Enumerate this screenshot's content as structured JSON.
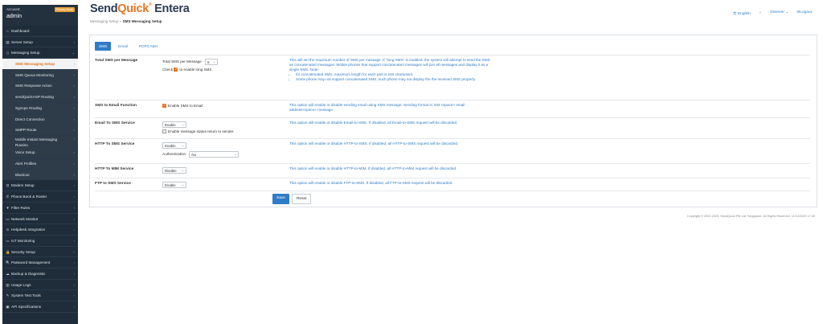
{
  "account": {
    "label": "Account:",
    "name": "admin",
    "badge": "Primary Node"
  },
  "sidebar": {
    "items": [
      {
        "icon": "⌂",
        "label": "Dashboard",
        "chevron": ""
      },
      {
        "icon": "▤",
        "label": "Server Setup",
        "chevron": "›"
      },
      {
        "icon": "▯",
        "label": "Messaging Setup",
        "chevron": "⌄"
      },
      {
        "label": "SMS Messaging Setup",
        "chevron": "›"
      },
      {
        "label": "SMS Queue Monitoring",
        "chevron": "›"
      },
      {
        "label": "SMS Response Action",
        "chevron": "›"
      },
      {
        "label": "sendQuickASP Routing",
        "chevron": "›"
      },
      {
        "label": "Sgnope Routing",
        "chevron": "›"
      },
      {
        "label": "Direct Connection",
        "chevron": "›"
      },
      {
        "label": "SMPP Route",
        "chevron": "›"
      },
      {
        "label": "Mobile Instant Messaging Routing",
        "chevron": "›"
      },
      {
        "label": "Voice Setup",
        "chevron": "›"
      },
      {
        "label": "Alert Profiles",
        "chevron": "›"
      },
      {
        "label": "Blackout",
        "chevron": "›"
      },
      {
        "icon": "⊡",
        "label": "Modem Setup",
        "chevron": "›"
      },
      {
        "icon": "✆",
        "label": "Phone Book & Roster",
        "chevron": "›"
      },
      {
        "icon": "▼",
        "label": "Filter Rules",
        "chevron": "›"
      },
      {
        "icon": "▭",
        "label": "Network Monitor",
        "chevron": "›"
      },
      {
        "icon": "⊙",
        "label": "Helpdesk Integration",
        "chevron": "›"
      },
      {
        "icon": "▭",
        "label": "IoT Monitoring",
        "chevron": "›"
      },
      {
        "icon": "🔒",
        "label": "Security Setup",
        "chevron": "›"
      },
      {
        "icon": "🔍",
        "label": "Password Management",
        "chevron": "›"
      },
      {
        "icon": "☁",
        "label": "Backup & Diagnostic",
        "chevron": "›"
      },
      {
        "icon": "▥",
        "label": "Usage Logs",
        "chevron": "›"
      },
      {
        "icon": "✎",
        "label": "System Test Tools",
        "chevron": "›"
      },
      {
        "icon": "▣",
        "label": "API Specifications",
        "chevron": "›"
      }
    ]
  },
  "header": {
    "logo_a": "Send",
    "logo_q": "Quick",
    "logo_reg": "®",
    "logo_b": " Entera",
    "breadcrumb_parent": "Messaging Setup",
    "breadcrumb_sep": " » ",
    "breadcrumb_current": "SMS Messaging Setup",
    "lang": "文 English",
    "lang_chev": "⌄",
    "server": "⊙Server ⌄",
    "logout": "⊖Logout"
  },
  "tabs": [
    "SMS",
    "Email",
    "POP3 Alert"
  ],
  "rows": {
    "total": {
      "label": "Total SMS per Message",
      "field_label": "Total SMS per Message",
      "value": "5",
      "check_pre": "Check",
      "check_post": "to enable long SMS",
      "help": "This will set the maximum number of SMS per message. If \"long SMS\" is enabled, the system will attempt to send the SMS as concatenated messages. Mobile phones that support concatenated messages will join all messages and display it as a single SMS. Note:",
      "bullets": [
        "for concatenated SMS, maximum length for each part is 153 characters.",
        "Some phone may not support concatenated SMS, such phone may not display the the received SMS properly."
      ]
    },
    "s2e": {
      "label": "SMS to Email Function",
      "check_label": "Enable SMS to Email",
      "help": "This option will enable or disable sending email using SMS message. Sending format is: EM <space> email address<space> message"
    },
    "e2s": {
      "label": "Email To SMS Service",
      "value": "Enable",
      "check_label": "Enable message status return to sender.",
      "help": "This option will enable or disable Email-to-SMS. If disabled, all Email-to-SMS request will be discarded."
    },
    "http": {
      "label": "HTTP To SMS Service",
      "value": "Enable",
      "auth_label": "Authentication",
      "auth_value": "No",
      "help": "This option will enable or disable HTTP-to-SMS. If disabled, all HTTP-to-SMS request will be discarded."
    },
    "mim": {
      "label": "HTTP To MIM Service",
      "value": "Disable",
      "help": "This option will enable or disable HTTP-to-MIM. If disabled, all HTTP-to-MIM request will be discarded."
    },
    "ftp": {
      "label": "FTP to SMS Service",
      "value": "Enable",
      "help": "This option will enable or disable FTP-to-SMS. If disabled, all FTP-to-SMS request will be discarded."
    }
  },
  "buttons": {
    "save": "Save",
    "reset": "Reset"
  },
  "footer": "Copyright © 2002-2025, SendQuick Pte Ltd, Singapore. All Rights Reserved. 11/12/2025 17:26",
  "colors": {
    "sidebar": "#1f2d3a",
    "accent": "#e8741e",
    "link": "#2f7cc8"
  }
}
